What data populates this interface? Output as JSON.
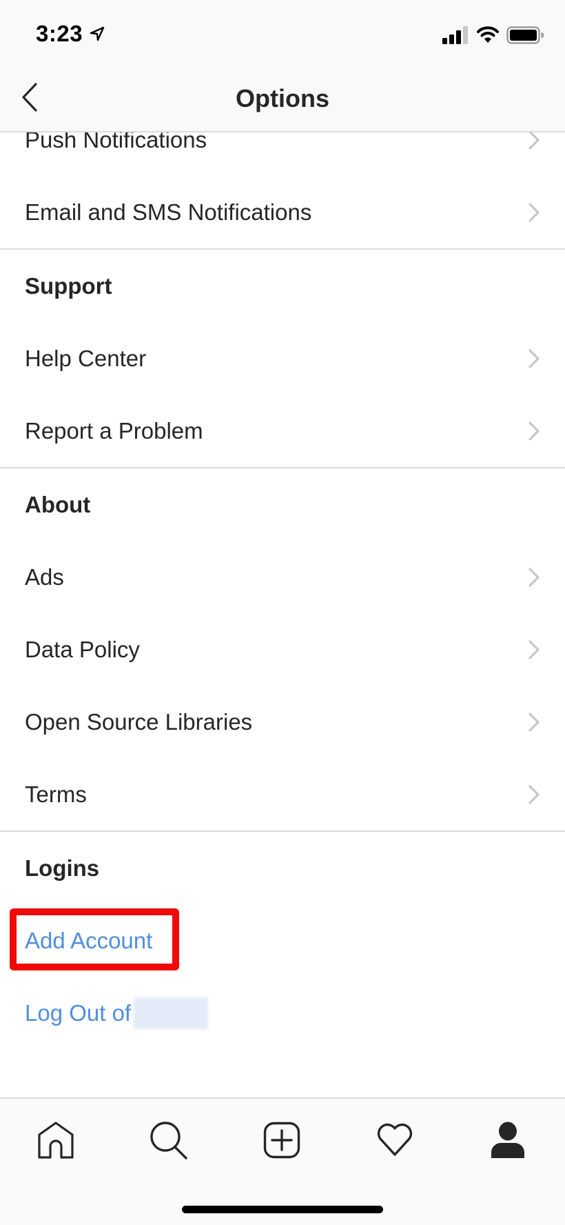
{
  "status_bar": {
    "time": "3:23",
    "location_icon": "location-arrow-icon",
    "signal_icon": "cellular-signal-icon",
    "wifi_icon": "wifi-icon",
    "battery_icon": "battery-icon"
  },
  "nav": {
    "title": "Options",
    "back_icon": "chevron-left-icon"
  },
  "sections": {
    "notifications": {
      "items": [
        {
          "label": "Push Notifications"
        },
        {
          "label": "Email and SMS Notifications"
        }
      ]
    },
    "support": {
      "header": "Support",
      "items": [
        {
          "label": "Help Center"
        },
        {
          "label": "Report a Problem"
        }
      ]
    },
    "about": {
      "header": "About",
      "items": [
        {
          "label": "Ads"
        },
        {
          "label": "Data Policy"
        },
        {
          "label": "Open Source Libraries"
        },
        {
          "label": "Terms"
        }
      ]
    },
    "logins": {
      "header": "Logins",
      "add_account": "Add Account",
      "log_out_prefix": "Log Out of"
    }
  },
  "tab_bar": {
    "tabs": [
      {
        "name": "home",
        "icon": "home-icon"
      },
      {
        "name": "search",
        "icon": "search-icon"
      },
      {
        "name": "new-post",
        "icon": "plus-square-icon"
      },
      {
        "name": "activity",
        "icon": "heart-icon"
      },
      {
        "name": "profile",
        "icon": "profile-icon",
        "active": true
      }
    ]
  },
  "colors": {
    "link_blue": "#4f8fde",
    "highlight_red": "#ee0a0a",
    "text_dark": "#262626",
    "separator": "#dbdbdb"
  }
}
